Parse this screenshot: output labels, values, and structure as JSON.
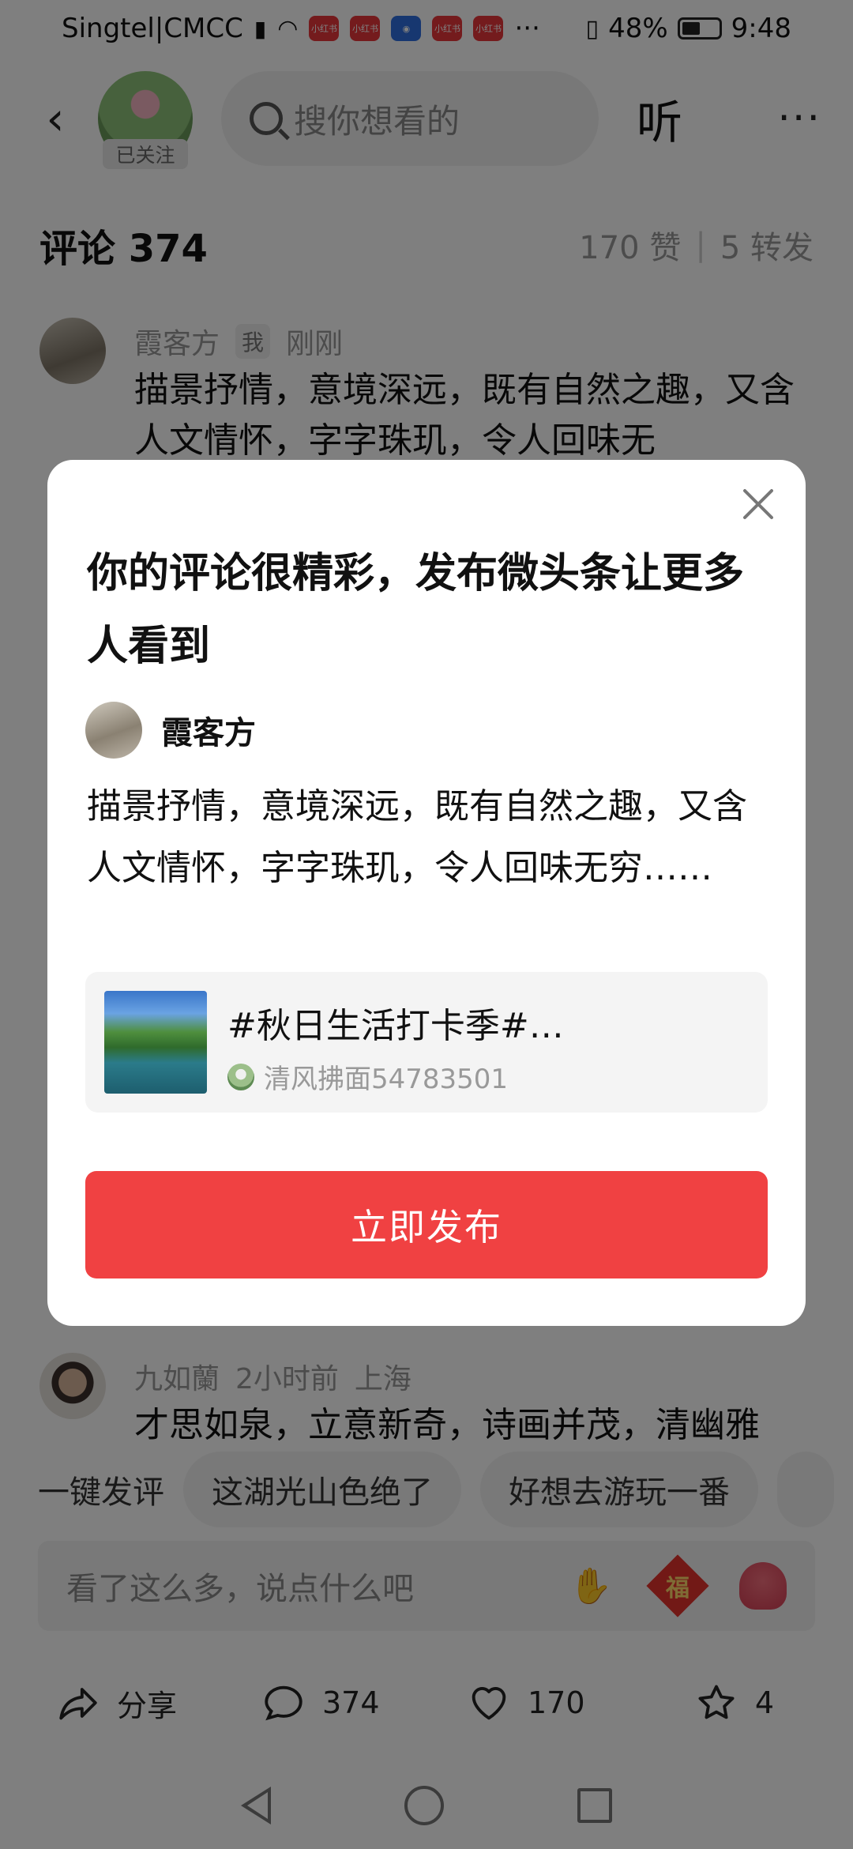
{
  "status_bar": {
    "carrier": "Singtel|CMCC",
    "mini_app_label": "小红书",
    "battery": "48%",
    "time": "9:48"
  },
  "top_bar": {
    "follow_tag": "已关注",
    "search_placeholder": "搜你想看的",
    "listen": "听",
    "more": "···"
  },
  "comments_header": {
    "title": "评论 374",
    "likes": "170 赞",
    "shares": "5 转发"
  },
  "comments": [
    {
      "author": "霞客方",
      "tag": "我",
      "time": "刚刚",
      "text": "描景抒情，意境深远，既有自然之趣，又含人文情怀，字字珠玑，令人回味无"
    },
    {
      "author": "九如蘭",
      "time": "2小时前",
      "location": "上海",
      "text": "才思如泉，立意新奇，诗画并茂，清幽雅"
    }
  ],
  "quick_replies": {
    "label": "一键发评",
    "chips": [
      "这湖光山色绝了",
      "好想去游玩一番"
    ]
  },
  "input_bar": {
    "placeholder": "看了这么多，说点什么吧",
    "fu_emoji": "福"
  },
  "bottom_actions": {
    "share": "分享",
    "comments": "374",
    "likes": "170",
    "favorites": "4"
  },
  "dialog": {
    "title": "你的评论很精彩，发布微头条让更多人看到",
    "author": "霞客方",
    "text": "描景抒情，意境深远，既有自然之趣，又含人文情怀，字字珠玑，令人回味无穷……",
    "card": {
      "title": "#秋日生活打卡季#…",
      "user": "清风拂面54783501"
    },
    "publish_button": "立即发布"
  }
}
